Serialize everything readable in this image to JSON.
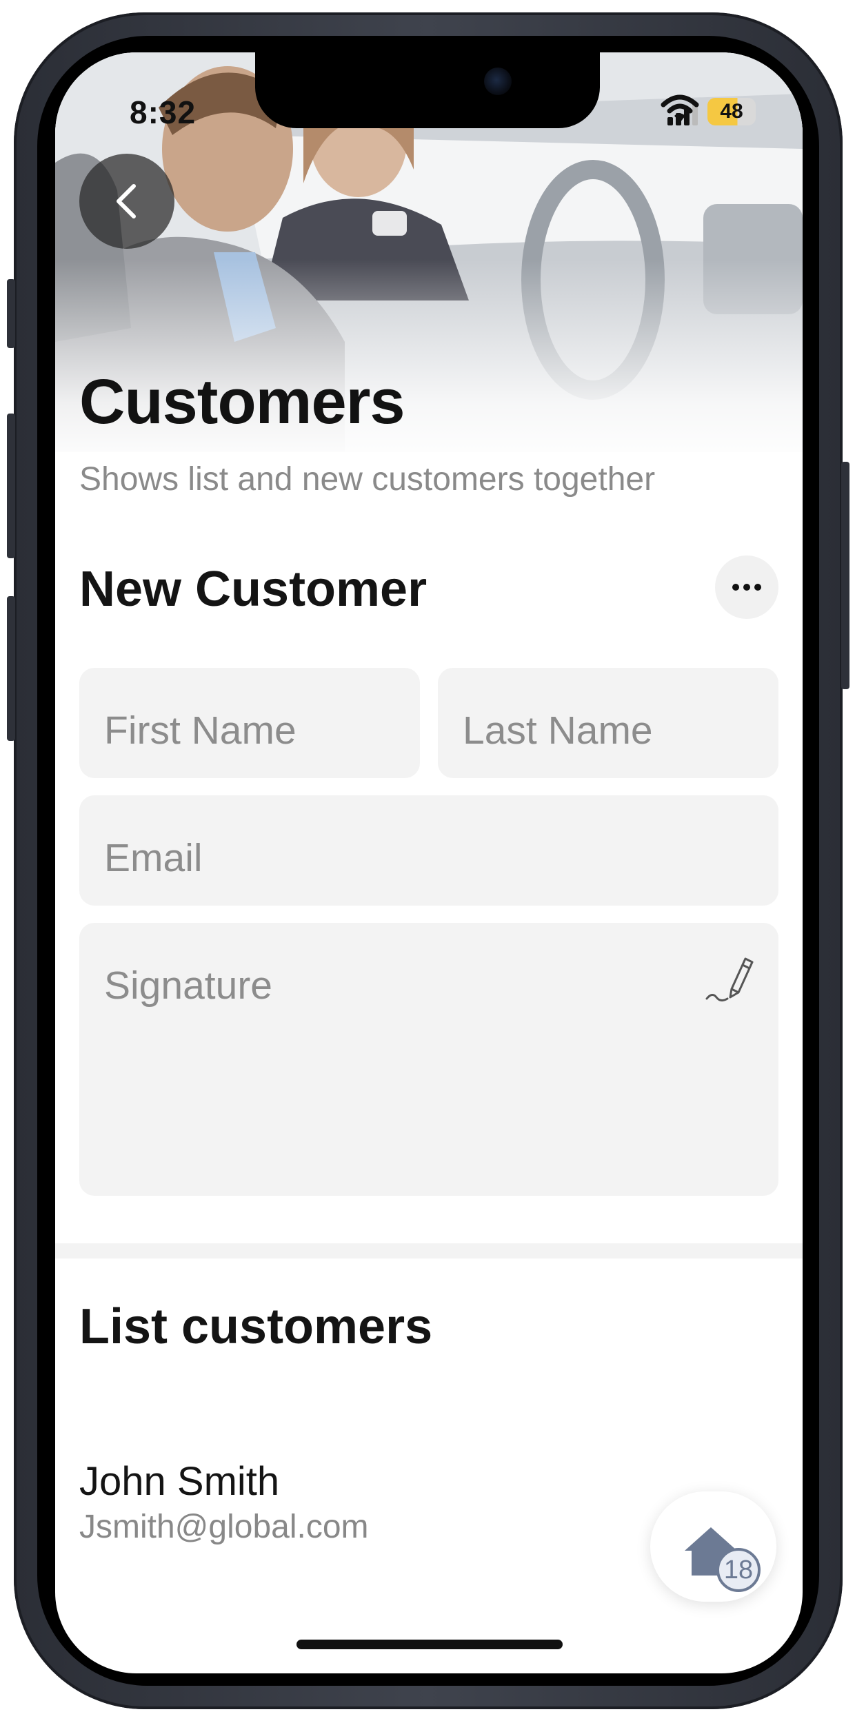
{
  "status_bar": {
    "time": "8:32",
    "battery_level": "48",
    "icons": [
      "cellular-signal-icon",
      "wifi-icon",
      "battery-icon"
    ]
  },
  "header": {
    "back_icon": "chevron-left-icon",
    "title": "Customers",
    "subtitle": "Shows list and new customers together"
  },
  "new_customer": {
    "title": "New Customer",
    "more_icon": "ellipsis-icon",
    "first_name_placeholder": "First Name",
    "last_name_placeholder": "Last Name",
    "email_placeholder": "Email",
    "signature_placeholder": "Signature",
    "signature_icon": "pen-signature-icon"
  },
  "list_customers": {
    "title": "List customers",
    "items": [
      {
        "name": "John Smith",
        "email": "Jsmith@global.com"
      }
    ]
  },
  "fab": {
    "icon": "home-icon",
    "badge": "18"
  },
  "colors": {
    "field_background": "#f3f3f3",
    "title_text": "#141414",
    "secondary_text": "#8a8a8a",
    "battery": "#f5c842",
    "badge": "#6c7a94"
  }
}
